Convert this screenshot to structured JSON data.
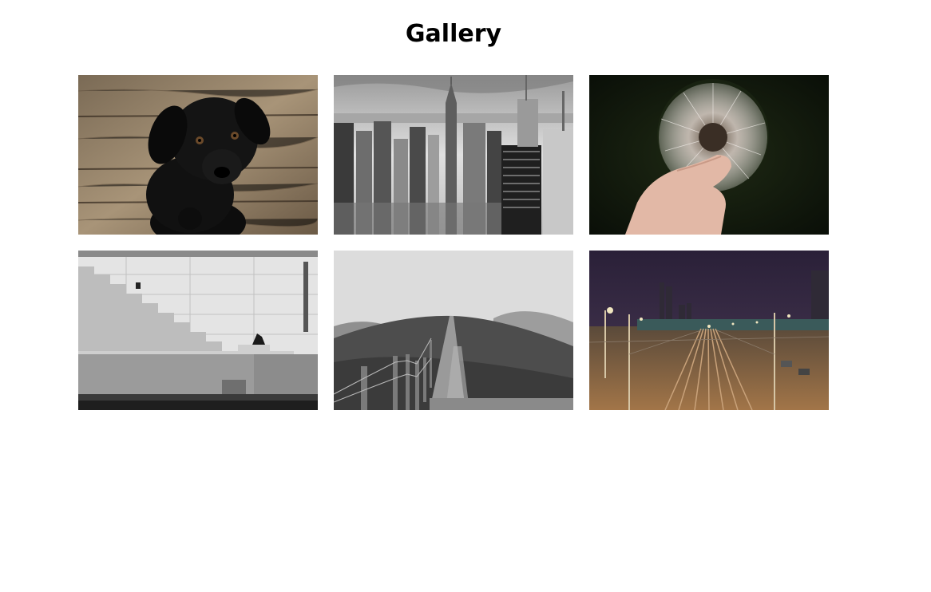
{
  "page": {
    "title": "Gallery"
  },
  "gallery": {
    "images": [
      {
        "subject": "black-puppy-on-wood-floor",
        "tone": "sepia"
      },
      {
        "subject": "city-skyline-aerial",
        "tone": "grayscale"
      },
      {
        "subject": "hand-holding-dandelion",
        "tone": "dark-green"
      },
      {
        "subject": "person-on-stone-stairs",
        "tone": "grayscale"
      },
      {
        "subject": "hill-path-with-fence",
        "tone": "grayscale"
      },
      {
        "subject": "railway-tracks-at-night",
        "tone": "warm-purple"
      }
    ]
  }
}
